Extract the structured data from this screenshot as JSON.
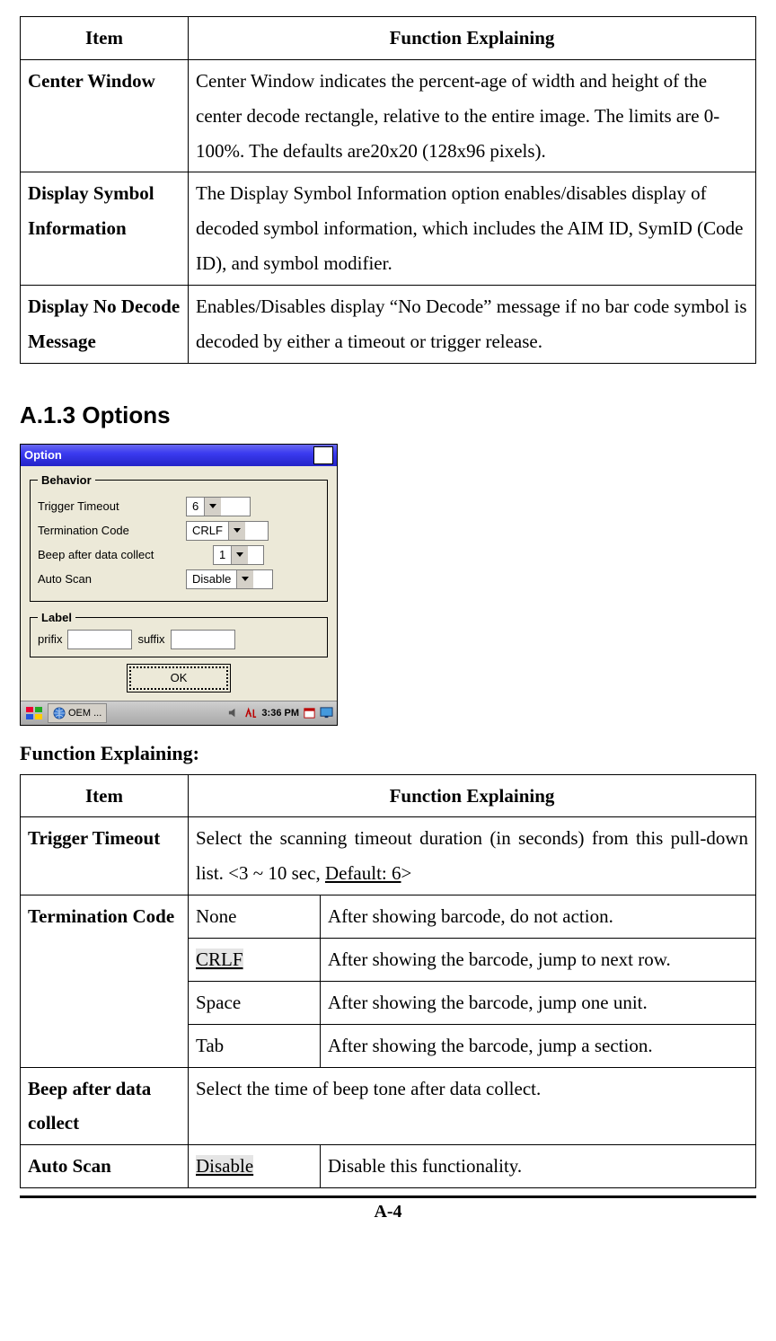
{
  "table1": {
    "headers": [
      "Item",
      "Function Explaining"
    ],
    "rows": [
      {
        "item": "Center Window",
        "text": "Center Window indicates the percent-age of width and height of the center decode rectangle, relative to the entire image. The limits are 0-100%. The defaults are20x20 (128x96 pixels)."
      },
      {
        "item": "Display Symbol Information",
        "text": "The Display Symbol Information option enables/disables display of decoded symbol information, which includes the AIM ID, SymID (Code ID), and symbol modifier."
      },
      {
        "item": "Display No Decode Message",
        "text": "Enables/Disables display “No Decode” message if no bar code symbol is decoded by either a timeout or trigger release."
      }
    ]
  },
  "section_heading": "A.1.3 Options",
  "dialog": {
    "title": "Option",
    "behavior_legend": "Behavior",
    "label_legend": "Label",
    "trigger_timeout_label": "Trigger Timeout",
    "trigger_timeout_value": "6",
    "termination_code_label": "Termination Code",
    "termination_code_value": "CRLF",
    "beep_label": "Beep after data collect",
    "beep_value": "1",
    "auto_scan_label": "Auto Scan",
    "auto_scan_value": "Disable",
    "prefix_label": "prifix",
    "suffix_label": "suffix",
    "ok_label": "OK"
  },
  "taskbar": {
    "task_label": "OEM ...",
    "time": "3:36 PM"
  },
  "subheading": "Function Explaining:",
  "table2": {
    "headers": [
      "Item",
      "Function Explaining"
    ],
    "trigger": {
      "item": "Trigger Timeout",
      "text_before": "Select the scanning timeout duration (in seconds) from this pull-down list. <3 ~ 10 sec, ",
      "default_text": "Default: 6",
      "text_after": ">"
    },
    "term": {
      "item": "Termination Code",
      "rows": [
        {
          "code": "None",
          "desc": "After showing barcode, do not action.",
          "hl": false
        },
        {
          "code": "CRLF",
          "desc": "After showing the barcode, jump to next row.",
          "hl": true
        },
        {
          "code": "Space",
          "desc": "After showing the barcode, jump one unit.",
          "hl": false
        },
        {
          "code": "Tab",
          "desc": "After showing the barcode, jump a section.",
          "hl": false
        }
      ]
    },
    "beep": {
      "item": "Beep after data collect",
      "text": "Select the time of beep tone after data collect."
    },
    "auto": {
      "item": "Auto Scan",
      "code": "Disable",
      "desc": "Disable this functionality."
    }
  },
  "page_number": "A-4"
}
